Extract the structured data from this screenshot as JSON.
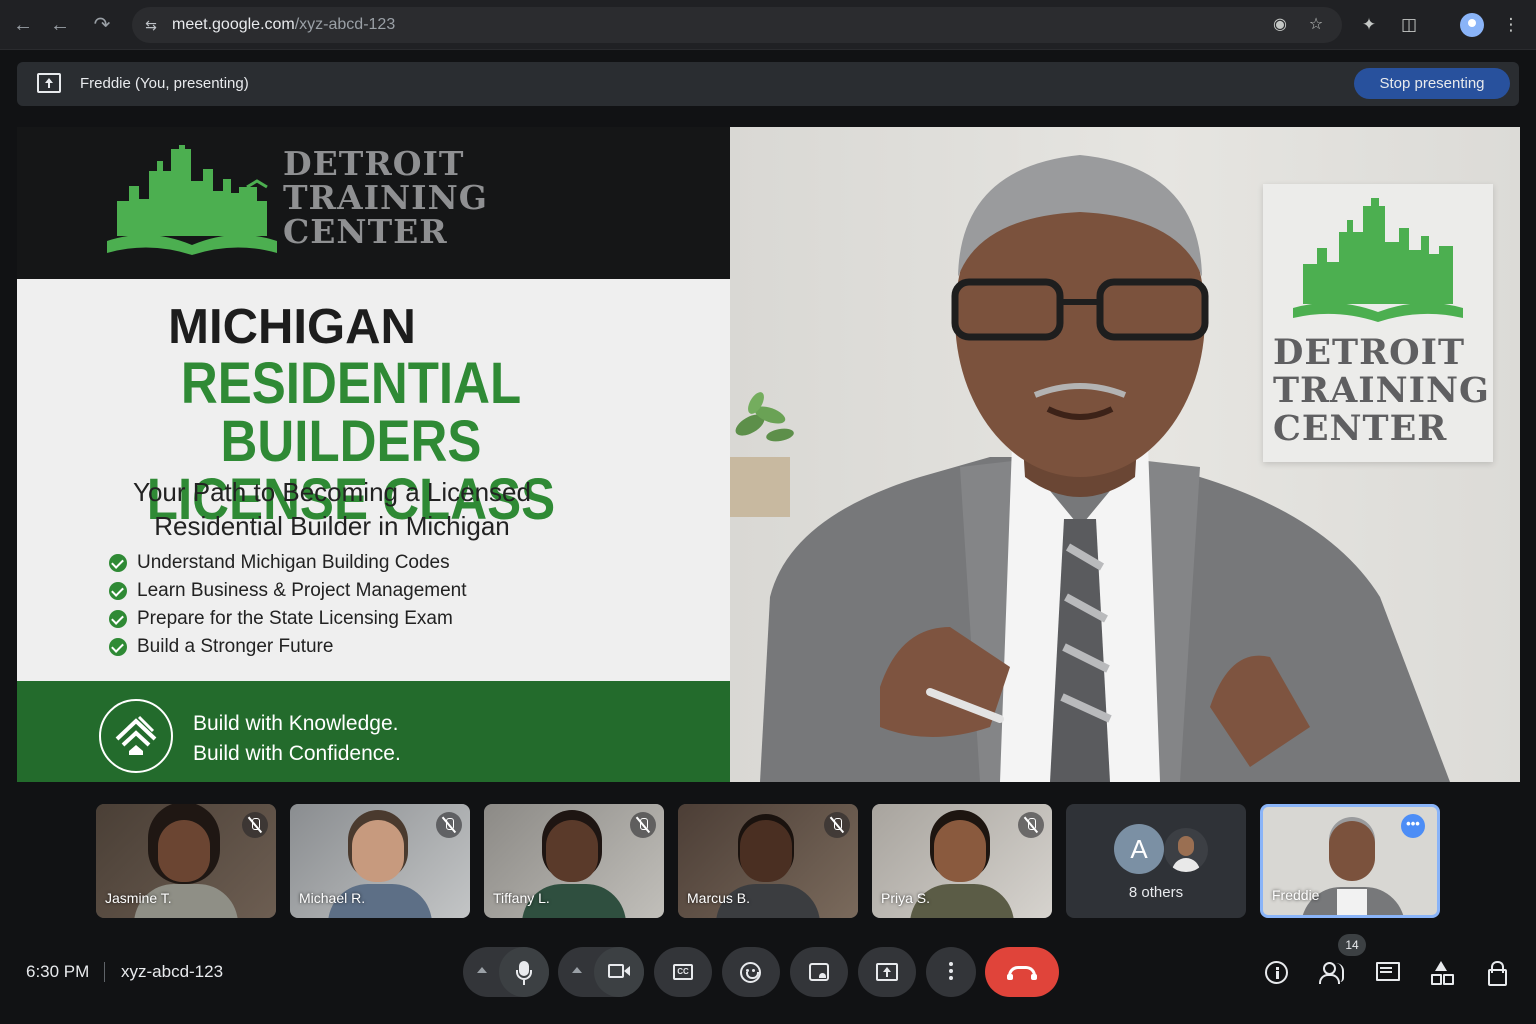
{
  "browser": {
    "url_host": "meet.google.com",
    "url_path": "/xyz-abcd-123"
  },
  "presenting": {
    "label": "Freddie (You, presenting)",
    "stop_label": "Stop presenting"
  },
  "slide": {
    "brand": [
      "DETROIT",
      "TRAINING",
      "CENTER"
    ],
    "heading_top": "MICHIGAN",
    "heading_main": [
      "RESIDENTIAL BUILDERS",
      "LICENSE CLASS"
    ],
    "subtitle": [
      "Your Path to Becoming a Licensed",
      "Residential Builder in Michigan"
    ],
    "bullets": [
      "Understand Michigan Building Codes",
      "Learn Business & Project Management",
      "Prepare for the State Licensing Exam",
      "Build a Stronger Future"
    ],
    "tagline": [
      "Build with Knowledge.",
      "Build with Confidence."
    ],
    "accent_green": "#2f8a35",
    "footer_green": "#236b2c"
  },
  "speaker": {
    "poster_text": [
      "DETROIT",
      "TRAINING",
      "CENTER"
    ]
  },
  "participants": [
    {
      "name": "Jasmine T.",
      "muted": true
    },
    {
      "name": "Michael R.",
      "muted": true
    },
    {
      "name": "Tiffany L.",
      "muted": true
    },
    {
      "name": "Marcus B.",
      "muted": true
    },
    {
      "name": "Priya S.",
      "muted": true
    }
  ],
  "others": {
    "avatar_letter": "A",
    "label": "8 others"
  },
  "self_tile": {
    "name": "Freddie"
  },
  "meeting": {
    "time": "6:30 PM",
    "code": "xyz-abcd-123",
    "participant_count": "14"
  },
  "colors": {
    "hangup": "#e0443a",
    "stop_button": "#28519d",
    "active_tile_border": "#8ab4f8"
  }
}
